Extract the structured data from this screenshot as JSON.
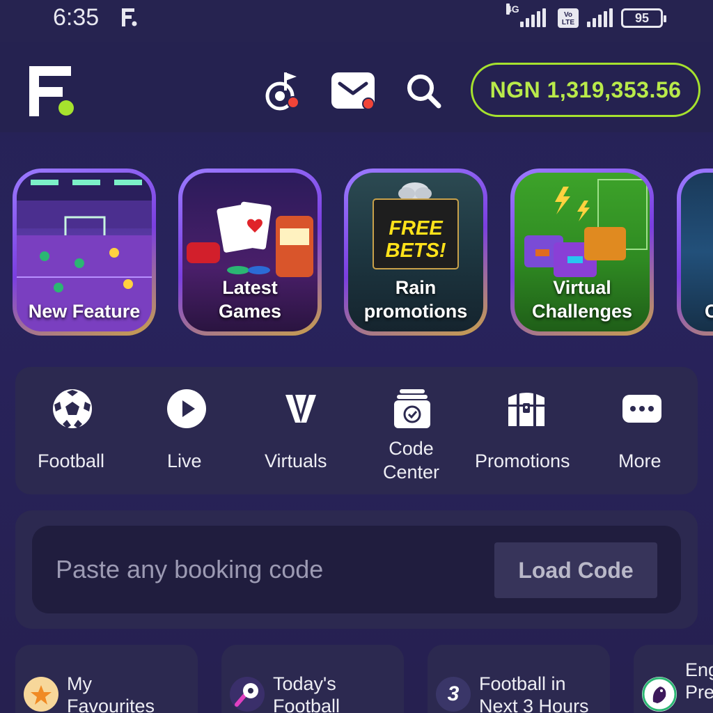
{
  "status_bar": {
    "time": "6:35",
    "network": "4G",
    "volte": "Vo LTE",
    "battery": "95"
  },
  "header": {
    "logo": "F-logo",
    "icons": [
      "target-flag-icon",
      "mail-icon",
      "search-icon"
    ],
    "balance": "NGN 1,319,353.56",
    "accent_color": "#a6e22e",
    "badge_color": "#f04438"
  },
  "stories": [
    {
      "label_line1": "New Feature",
      "label_line2": ""
    },
    {
      "label_line1": "Latest",
      "label_line2": "Games"
    },
    {
      "label_line1": "Rain",
      "label_line2": "promotions",
      "art_text_1": "FREE",
      "art_text_2": "BETS!"
    },
    {
      "label_line1": "Virtual",
      "label_line2": "Challenges"
    },
    {
      "label_line1": "C",
      "label_line2": ""
    }
  ],
  "quick_menu": {
    "items": [
      {
        "label": "Football",
        "icon": "soccer-ball-icon"
      },
      {
        "label": "Live",
        "icon": "play-icon"
      },
      {
        "label": "Virtuals",
        "icon": "virtuals-v-icon"
      },
      {
        "label_line1": "Code",
        "label_line2": "Center",
        "icon": "code-center-icon"
      },
      {
        "label": "Promotions",
        "icon": "treasure-chest-icon"
      },
      {
        "label": "More",
        "icon": "more-dots-icon"
      }
    ]
  },
  "booking": {
    "placeholder": "Paste any booking code",
    "button_label": "Load Code"
  },
  "shortcuts": [
    {
      "line1": "My",
      "line2": "Favourites",
      "icon": "star-icon"
    },
    {
      "line1": "Today's",
      "line2": "Football",
      "icon": "rocket-football-icon"
    },
    {
      "line1": "Football in",
      "line2": "Next 3 Hours",
      "icon": "number-3-icon",
      "icon_text": "3"
    },
    {
      "line1": "Eng",
      "line2": "Pre",
      "icon": "premier-league-lion-icon"
    }
  ]
}
